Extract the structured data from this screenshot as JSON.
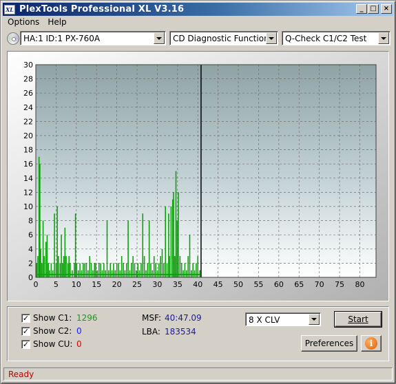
{
  "window": {
    "icon_text": "XL",
    "title": "PlexTools Professional XL V3.16",
    "minimize": "_",
    "maximize": "□",
    "close": "×"
  },
  "menu": {
    "items": [
      "Options",
      "Help"
    ]
  },
  "toolbar": {
    "drive": "HA:1 ID:1  PX-760A",
    "function": "CD Diagnostic Functions",
    "test": "Q-Check C1/C2 Test"
  },
  "chart_data": {
    "type": "bar",
    "title": "",
    "xlabel": "",
    "ylabel": "",
    "x_ticks": [
      "0",
      "5",
      "10",
      "15",
      "20",
      "25",
      "30",
      "35",
      "40",
      "45",
      "50",
      "55",
      "60",
      "65",
      "70",
      "75",
      "80"
    ],
    "y_ticks": [
      "0",
      "2",
      "4",
      "6",
      "8",
      "10",
      "12",
      "14",
      "16",
      "18",
      "20",
      "22",
      "24",
      "26",
      "28",
      "30"
    ],
    "xlim": [
      0,
      84
    ],
    "ylim": [
      0,
      30
    ],
    "grid": true,
    "progress_marker_x": 40.8,
    "series": [
      {
        "color": "#12a012",
        "points": [
          [
            0.2,
            2
          ],
          [
            0.5,
            3
          ],
          [
            0.8,
            17
          ],
          [
            1.0,
            16
          ],
          [
            1.2,
            4
          ],
          [
            1.5,
            2
          ],
          [
            1.8,
            8
          ],
          [
            2.1,
            3
          ],
          [
            2.5,
            5
          ],
          [
            2.8,
            6
          ],
          [
            3.1,
            2
          ],
          [
            3.4,
            1
          ],
          [
            3.8,
            2
          ],
          [
            4.2,
            1
          ],
          [
            4.6,
            9
          ],
          [
            5.0,
            2
          ],
          [
            5.3,
            10
          ],
          [
            5.6,
            3
          ],
          [
            6.0,
            2
          ],
          [
            6.3,
            6
          ],
          [
            6.6,
            2
          ],
          [
            6.9,
            3
          ],
          [
            7.2,
            7
          ],
          [
            7.5,
            3
          ],
          [
            7.9,
            2
          ],
          [
            8.2,
            3
          ],
          [
            8.5,
            2
          ],
          [
            9.0,
            1
          ],
          [
            9.5,
            2
          ],
          [
            9.8,
            9
          ],
          [
            10.1,
            2
          ],
          [
            10.5,
            1
          ],
          [
            10.9,
            2
          ],
          [
            11.3,
            1
          ],
          [
            11.7,
            2
          ],
          [
            12.1,
            2
          ],
          [
            12.5,
            2
          ],
          [
            12.9,
            1
          ],
          [
            13.3,
            3
          ],
          [
            13.7,
            2
          ],
          [
            14.1,
            1
          ],
          [
            14.5,
            2
          ],
          [
            14.8,
            2
          ],
          [
            15.2,
            1
          ],
          [
            15.6,
            2
          ],
          [
            16.0,
            2
          ],
          [
            16.4,
            1
          ],
          [
            16.8,
            2
          ],
          [
            17.2,
            1
          ],
          [
            17.6,
            8
          ],
          [
            18.0,
            1
          ],
          [
            18.4,
            2
          ],
          [
            18.8,
            1
          ],
          [
            19.2,
            2
          ],
          [
            19.6,
            1
          ],
          [
            20.0,
            2
          ],
          [
            20.4,
            2
          ],
          [
            20.8,
            1
          ],
          [
            21.2,
            3
          ],
          [
            21.6,
            2
          ],
          [
            22.0,
            1
          ],
          [
            22.4,
            2
          ],
          [
            22.8,
            8
          ],
          [
            23.2,
            1
          ],
          [
            23.6,
            2
          ],
          [
            24.0,
            3
          ],
          [
            24.4,
            2
          ],
          [
            24.8,
            1
          ],
          [
            25.2,
            2
          ],
          [
            25.6,
            1
          ],
          [
            26.0,
            2
          ],
          [
            26.4,
            9
          ],
          [
            26.8,
            3
          ],
          [
            27.2,
            1
          ],
          [
            27.6,
            2
          ],
          [
            28.0,
            8
          ],
          [
            28.4,
            2
          ],
          [
            28.8,
            1
          ],
          [
            29.2,
            3
          ],
          [
            29.6,
            2
          ],
          [
            30.0,
            1
          ],
          [
            30.4,
            2
          ],
          [
            30.8,
            3
          ],
          [
            31.2,
            4
          ],
          [
            31.6,
            2
          ],
          [
            32.0,
            10
          ],
          [
            32.4,
            2
          ],
          [
            32.8,
            9
          ],
          [
            33.0,
            3
          ],
          [
            33.4,
            10
          ],
          [
            33.8,
            11
          ],
          [
            34.0,
            12
          ],
          [
            34.3,
            3
          ],
          [
            34.6,
            15
          ],
          [
            34.9,
            8
          ],
          [
            35.2,
            12
          ],
          [
            35.6,
            3
          ],
          [
            36.0,
            2
          ],
          [
            36.4,
            1
          ],
          [
            36.8,
            2
          ],
          [
            37.2,
            1
          ],
          [
            37.6,
            3
          ],
          [
            38.0,
            6
          ],
          [
            38.4,
            1
          ],
          [
            38.8,
            2
          ],
          [
            39.2,
            1
          ],
          [
            39.6,
            2
          ],
          [
            40.0,
            3
          ],
          [
            40.5,
            1
          ]
        ]
      }
    ]
  },
  "stats": {
    "show_c1_label": "Show C1:",
    "show_c2_label": "Show C2:",
    "show_cu_label": "Show CU:",
    "c1_value": "1296",
    "c2_value": "0",
    "cu_value": "0",
    "msf_label": "MSF:",
    "msf_value": "40:47.09",
    "lba_label": "LBA:",
    "lba_value": "183534",
    "c1_checked": "✓",
    "c2_checked": "✓",
    "cu_checked": "✓"
  },
  "controls": {
    "speed": "8 X CLV",
    "start": "Start",
    "preferences": "Preferences",
    "info_glyph": "i"
  },
  "status": {
    "text": "Ready",
    "color": "#c00000"
  }
}
